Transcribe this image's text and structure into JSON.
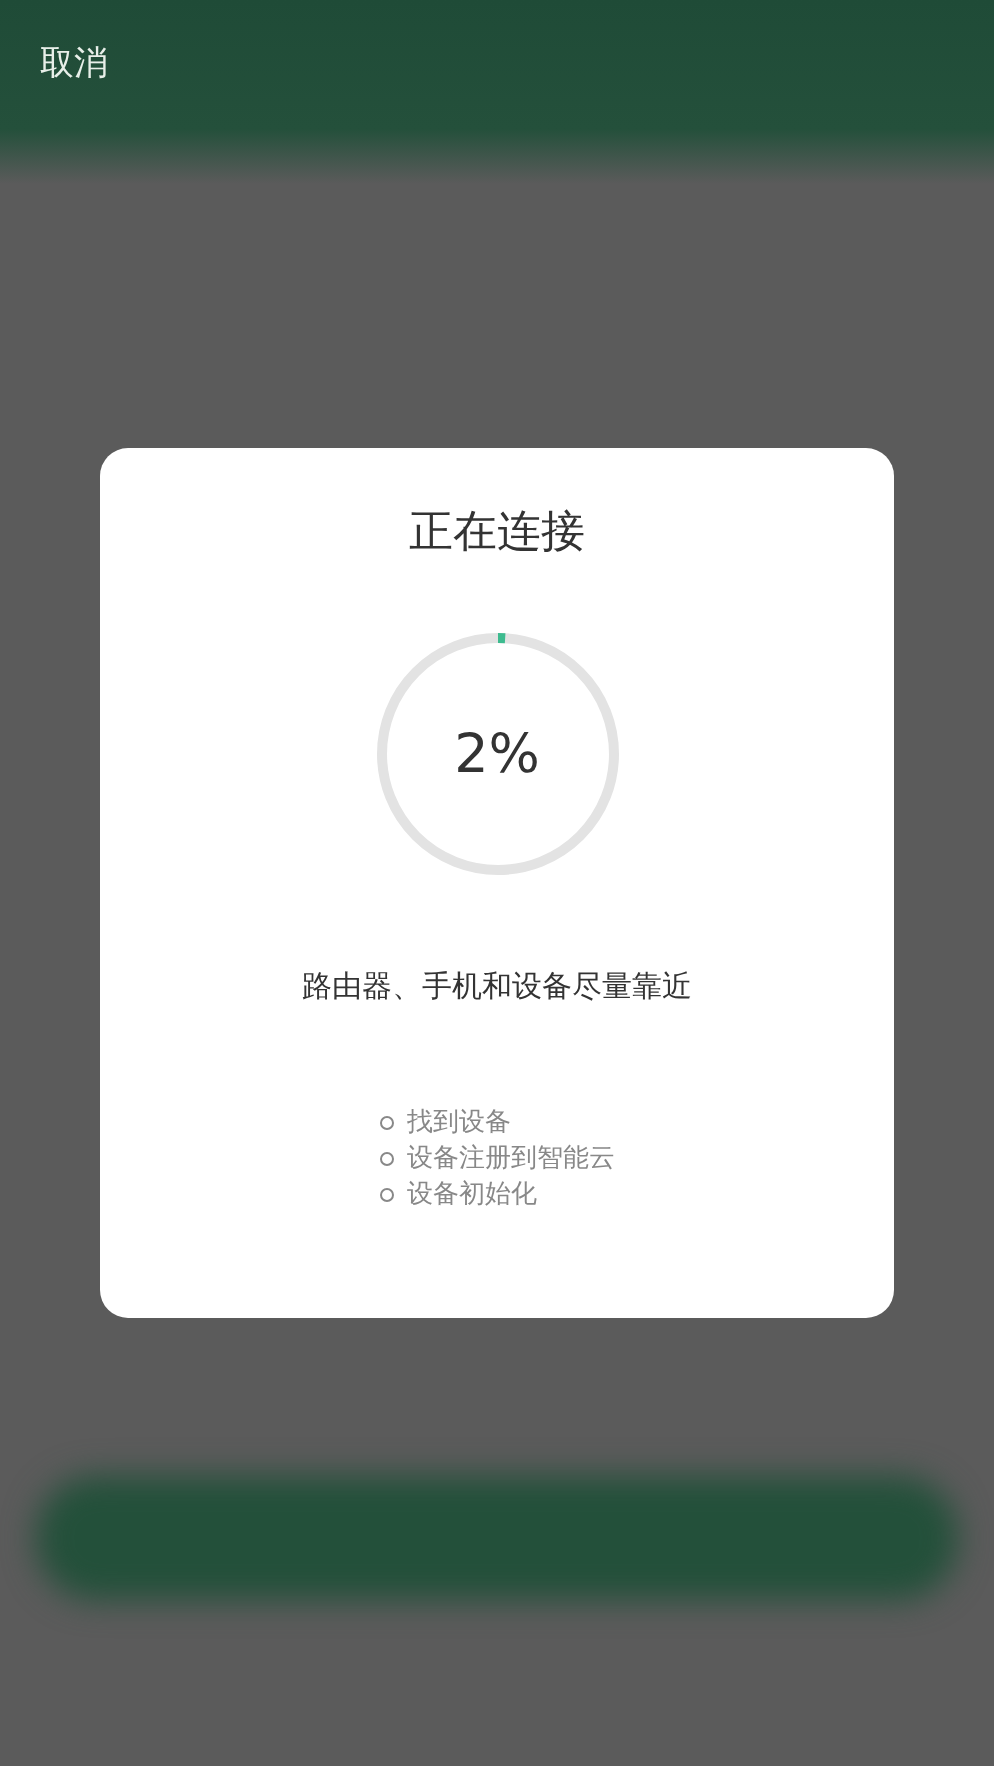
{
  "header": {
    "cancel": "取消"
  },
  "dialog": {
    "title": "正在连接",
    "progress": {
      "level": 0.02,
      "reading": "2%"
    },
    "hint": "路由器、手机和设备尽量靠近",
    "steps": [
      "找到设备",
      "设备注册到智能云",
      "设备初始化"
    ]
  }
}
